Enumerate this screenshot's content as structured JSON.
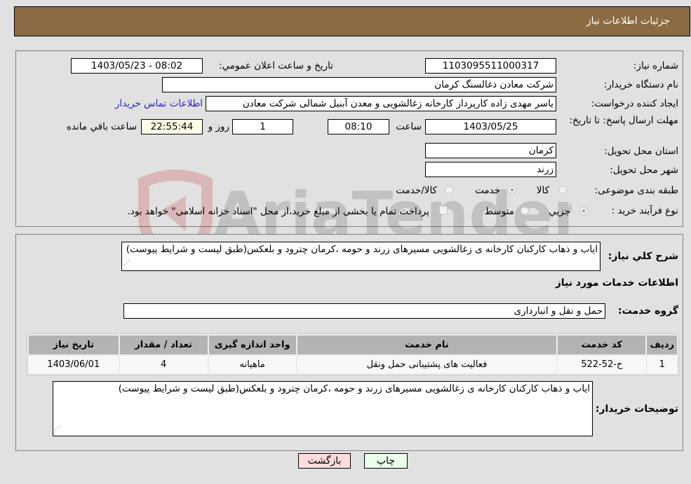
{
  "header": {
    "title": "جزئیات اطلاعات نیاز"
  },
  "form": {
    "need_number": {
      "label": "شماره نیاز:",
      "value": "1103095511000317"
    },
    "announce_datetime": {
      "label": "تاریخ و ساعت اعلان عمومي:",
      "value": "1403/05/23 - 08:02"
    },
    "buyer_org": {
      "label": "نام دستگاه خریدار:",
      "value": "شرکت معادن ذغالسنگ کرمان"
    },
    "requester": {
      "label": "ایجاد کننده درخواست:",
      "value": "یاسر مهدی زاده کارپرداز کارخانه زغالشویی و معدن آبنیل شمالی  شرکت معادن"
    },
    "buyer_contact_link": "اطلاعات تماس خریدار",
    "deadline": {
      "label": "مهلت ارسال پاسخ: تا تاریخ:",
      "date": "1403/05/25",
      "time_label": "ساعت",
      "time": "08:10",
      "days": "1",
      "days_label": "روز و",
      "remaining": "22:55:44",
      "remaining_label": "ساعت باقي مانده"
    },
    "province": {
      "label": "استان محل تحویل:",
      "value": "کرمان"
    },
    "city": {
      "label": "شهر محل تحویل:",
      "value": "زرند"
    },
    "category": {
      "label": "طبقه بندی موضوعی:",
      "options": [
        "کالا",
        "خدمت",
        "کالا/خدمت"
      ],
      "selected": "خدمت"
    },
    "purchase_type": {
      "label": "نوع فرآیند خرید :",
      "options": [
        "جزيي",
        "متوسط"
      ],
      "selected": "جزيي",
      "treasury_note": "پرداخت تمام یا بخشی از مبلغ خرید،از محل \"اسناد خزانه اسلامی\" خواهد بود."
    }
  },
  "details": {
    "summary_label": "شرح کلي نياز:",
    "summary_value": "اياب و ذهاب کارکنان کارخانه ی زغالشویی مسیرهای زرند و حومه ،کرمان چترود و بلعکس(طبق لیست و شرایط پیوست)",
    "services_heading": "اطلاعات خدمات مورد نیاز",
    "service_group_label": "گروه خدمت:",
    "service_group_value": "حمل و نقل و انبارداری",
    "table": {
      "headers": [
        "ردیف",
        "کد خدمت",
        "نام خدمت",
        "واحد اندازه گیری",
        "تعداد / مقدار",
        "تاریخ نیاز"
      ],
      "rows": [
        [
          "1",
          "ح-52-522",
          "فعالیت های پشتیبانی حمل ونقل",
          "ماهیانه",
          "4",
          "1403/06/01"
        ]
      ]
    },
    "buyer_notes_label": "توضیحات خریدار:",
    "buyer_notes_value": "اياب و ذهاب کارکنان کارخانه ی زغالشویی مسیرهای زرند و حومه ،کرمان چترود و بلعکس(طبق لیست و شرایط پیوست)"
  },
  "buttons": {
    "print": "چاپ",
    "back": "بازگشت"
  },
  "watermark": {
    "text": "AriaTender.neT"
  }
}
